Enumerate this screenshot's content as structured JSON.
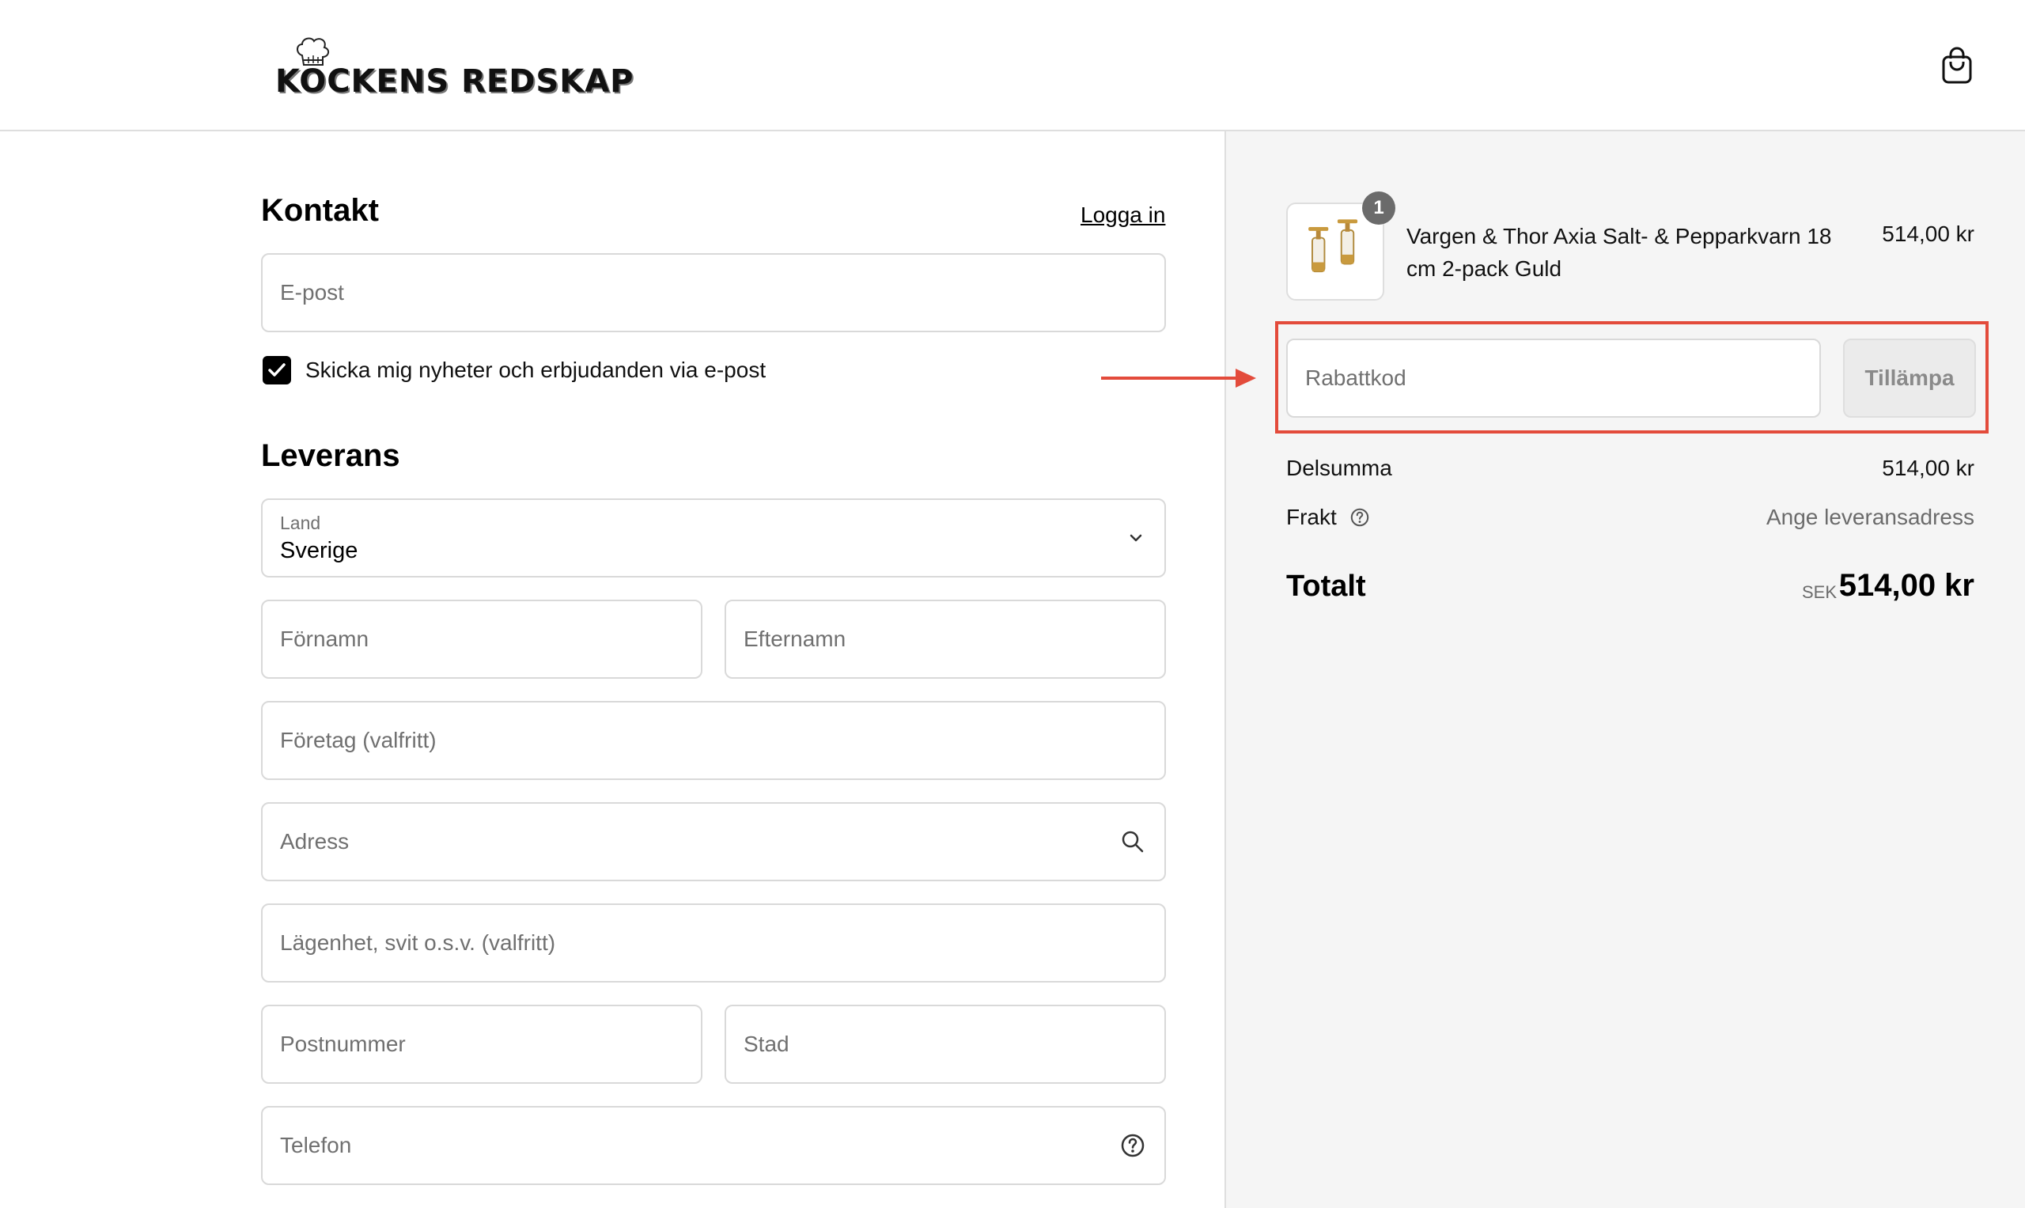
{
  "brand": {
    "name": "KOCKENS REDSKAP"
  },
  "icons": {
    "cart": "shopping-bag-icon",
    "chef": "chef-hat-icon"
  },
  "contact": {
    "title": "Kontakt",
    "login_label": "Logga in",
    "email_placeholder": "E-post",
    "newsletter_label": "Skicka mig nyheter och erbjudanden via e-post",
    "newsletter_checked": true
  },
  "delivery": {
    "title": "Leverans",
    "country_label": "Land",
    "country_value": "Sverige",
    "first_name_placeholder": "Förnamn",
    "last_name_placeholder": "Efternamn",
    "company_placeholder": "Företag (valfritt)",
    "address_placeholder": "Adress",
    "apartment_placeholder": "Lägenhet, svit o.s.v. (valfritt)",
    "postal_placeholder": "Postnummer",
    "city_placeholder": "Stad",
    "phone_placeholder": "Telefon"
  },
  "summary": {
    "product": {
      "name": "Vargen & Thor Axia Salt- & Pepparkvarn 18 cm 2-pack Guld",
      "price": "514,00 kr",
      "quantity": "1"
    },
    "discount_placeholder": "Rabattkod",
    "apply_label": "Tillämpa",
    "subtotal_label": "Delsumma",
    "subtotal_value": "514,00 kr",
    "shipping_label": "Frakt",
    "shipping_value": "Ange leveransadress",
    "total_label": "Totalt",
    "total_currency": "SEK",
    "total_value": "514,00 kr"
  },
  "colors": {
    "highlight": "#e34b3b",
    "panel": "#f5f5f5"
  }
}
